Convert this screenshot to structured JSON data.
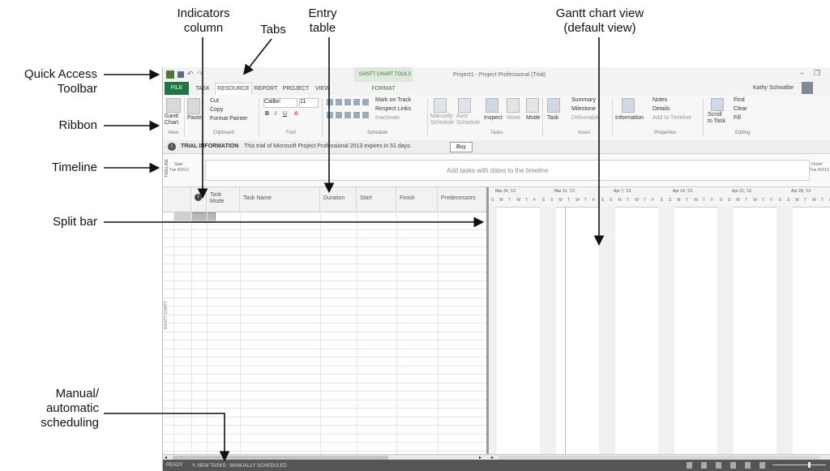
{
  "annotations": {
    "indicators_column": [
      "Indicators",
      "column"
    ],
    "tabs": "Tabs",
    "entry_table": [
      "Entry",
      "table"
    ],
    "gantt_chart_view": [
      "Gantt chart view",
      "(default view)"
    ],
    "quick_access_toolbar": [
      "Quick Access",
      "Toolbar"
    ],
    "ribbon": "Ribbon",
    "timeline": "Timeline",
    "split_bar": "Split bar",
    "manual_automatic_scheduling": [
      "Manual/",
      "automatic",
      "scheduling"
    ]
  },
  "titlebar": {
    "contextual_group": "GANTT CHART TOOLS",
    "title": "Project1 - Project Professional (Trial)",
    "user": "Kathy Schwalbe"
  },
  "tabs": [
    "FILE",
    "TASK",
    "RESOURCE",
    "REPORT",
    "PROJECT",
    "VIEW",
    "FORMAT"
  ],
  "ribbon": {
    "view": {
      "gantt_chart": [
        "Gantt",
        "Chart"
      ],
      "label": "View"
    },
    "clipboard": {
      "paste": "Paste",
      "cut": "Cut",
      "copy": "Copy",
      "format_painter": "Format Painter",
      "label": "Clipboard"
    },
    "font": {
      "name": "Calibri",
      "size": "11",
      "bold": "B",
      "italic": "I",
      "underline": "U",
      "label": "Font"
    },
    "schedule": {
      "mark_on_track": "Mark on Track",
      "respect_links": "Respect Links",
      "inactivate": "Inactivate",
      "label": "Schedule"
    },
    "tasks": {
      "manually_schedule": [
        "Manually",
        "Schedule"
      ],
      "auto_schedule": [
        "Auto",
        "Schedule"
      ],
      "inspect": "Inspect",
      "move": "Move",
      "mode": "Mode",
      "label": "Tasks"
    },
    "insert": {
      "task": "Task",
      "summary": "Summary",
      "milestone": "Milestone",
      "deliverable": "Deliverable",
      "label": "Insert"
    },
    "properties": {
      "information": "Information",
      "notes": "Notes",
      "details": "Details",
      "add_to_timeline": "Add to Timeline",
      "label": "Properties"
    },
    "editing": {
      "scroll_to_task": [
        "Scroll",
        "to Task"
      ],
      "find": "Find",
      "clear": "Clear",
      "fill": "Fill",
      "label": "Editing"
    }
  },
  "trial_bar": {
    "label": "TRIAL INFORMATION",
    "message": "This trial of Microsoft Project Professional 2013 expires in 51 days.",
    "buy": "Buy"
  },
  "timeline": {
    "side_label": "TIMELINE",
    "start_label": "Start",
    "start_date": "Tue 4/2/13",
    "finish_label": "Finish",
    "finish_date": "Tue 4/2/13",
    "placeholder": "Add tasks with dates to the timeline"
  },
  "table": {
    "headers": [
      "Task Mode",
      "Task Name",
      "Duration",
      "Start",
      "Finish",
      "Predecessors"
    ],
    "indicator_header": "i",
    "side_label": "GANTT CHART"
  },
  "gantt": {
    "weeks": [
      "Mar 24, '13",
      "Mar 31, '13",
      "Apr 7, '13",
      "Apr 14, '13",
      "Apr 21, '13",
      "Apr 28, '13"
    ],
    "day_letters": [
      "S",
      "M",
      "T",
      "W",
      "T",
      "F",
      "S"
    ]
  },
  "status": {
    "ready": "READY",
    "new_tasks": "NEW TASKS : MANUALLY SCHEDULED"
  }
}
